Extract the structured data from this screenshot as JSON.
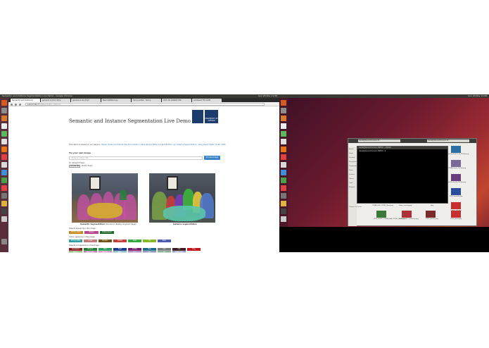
{
  "left_screen": {
    "topbar_title": "Semantic and Instance Segmentation Live Demo - Google Chrome",
    "topbar_tray": "Sun 20 Nov 11:38",
    "tabs": [
      "Semantic and Instance",
      "general matrix dims",
      "geneva-1-G2_Expr",
      "Nanodetfetch.py",
      "harry potter · fancy",
      "ICCV RL GRAND PRI",
      "unbiased TFA LMKI"
    ],
    "address": {
      "secure_label": "129.67.90.77",
      "path": "/deltavirtually_camera"
    },
    "page": {
      "title": "Semantic and Instance Segmentation Live Demo",
      "logo_text": "UNIVERSITY OF OXFORD",
      "intro_prefix": "This demo is based on our papers:",
      "intro_link1": "Higher Order Conditional Random Fields in Deep Neural Networks",
      "intro_mid": "and",
      "intro_link2": "Bottom-up Instance Segmentation using Deep Higher Order CRFs",
      "try_label": "Try your own image",
      "url_placeholder": "Enter an image URL",
      "process_button": "Process Image",
      "upload_label": "Or upload it here:",
      "choose_file": "Choose File",
      "no_file": "No file chosen",
      "caption_sem_bold": "Semantic Segmentation",
      "caption_sem_rest": "(mouse to display original image)",
      "caption_ins": "Instance segmentation",
      "legend_appearing": "Objects appearing in the image:",
      "legend_appearing_badges": [
        {
          "label": "Dining table",
          "color": "#c58a1e"
        },
        {
          "label": "Person",
          "color": "#b5488f"
        },
        {
          "label": "Potted plant",
          "color": "#1e6b2e"
        }
      ],
      "legend_indoor": "Indoor appearing in the image:",
      "legend_indoor_badges": [
        {
          "label": "Dining table",
          "color": "#2e9fa0"
        },
        {
          "label": "Chair",
          "color": "#c07a7a"
        },
        {
          "label": "Monitor",
          "color": "#6d5418"
        },
        {
          "label": "Bottle",
          "color": "#c0403a"
        },
        {
          "label": "Sofa",
          "color": "#3aa845"
        },
        {
          "label": "TV",
          "color": "#8ab82a"
        },
        {
          "label": "Plant",
          "color": "#4d5ab0"
        }
      ],
      "legend_not": "Objects not appearing in the image:",
      "legend_not_badges_row1": [
        {
          "label": "Aeroplane",
          "color": "#8a1e1e"
        },
        {
          "label": "Bicycle",
          "color": "#1e7a2e"
        },
        {
          "label": "Bird",
          "color": "#2e9f5a"
        },
        {
          "label": "Boat",
          "color": "#1e3c8a"
        },
        {
          "label": "Bottle",
          "color": "#7a1e6b"
        },
        {
          "label": "Bus",
          "color": "#1e6b8a"
        },
        {
          "label": "Car",
          "color": "#7a7a7a"
        },
        {
          "label": "Cat",
          "color": "#3c1e1e"
        },
        {
          "label": "Dog",
          "color": "#c0181e"
        }
      ],
      "legend_not_badges_row2": [
        {
          "label": "Horse",
          "color": "#3a8a2a"
        },
        {
          "label": "Motorbike",
          "color": "#8a1e8a"
        },
        {
          "label": "Sheep",
          "color": "#c03aa0"
        },
        {
          "label": "Train",
          "color": "#2a8ab0"
        },
        {
          "label": "Cow",
          "color": "#6b3a8a"
        },
        {
          "label": "Cat",
          "color": "#3a3a8a"
        },
        {
          "label": "TV",
          "color": "#2a6b3a"
        },
        {
          "label": "TV/Monitor",
          "color": "#3a5ab0"
        }
      ]
    }
  },
  "right_screen": {
    "topbar_tray": "Sun 20 Nov 11:38",
    "filemanager_tabs": [
      "daniel@daniel-Precision-M...",
      "daniel@daniel-Precision-M..."
    ],
    "sidebar_items": [
      "Places",
      "Home",
      "Desktop",
      "Documents",
      "Downloads",
      "Music",
      "Pictures",
      "Videos",
      "Trash",
      "Network",
      "Connect to Server"
    ],
    "terminal_title": "daniel@daniel-Precision-M4800: ~/deltaD",
    "terminal_line": "daniel@daniel-Precision-M4800:~$",
    "files_right": [
      "2010_001577_2s_TVObjt.png",
      "TV588_sheet_TVObjt.png",
      "2010_dereful_TVObjt.png",
      "2010_derdedt.png",
      "image_tail.png"
    ],
    "files_bottom": [
      {
        "name": "TV588_000_TVCNS_Obstr.png"
      },
      {
        "name": "shape_overlay.png"
      },
      {
        "name": "png"
      },
      {
        "name": "2010_001577_TV588_SAR_TVCNS_Obstr.png"
      },
      {
        "name": "2010_001577_Instance.png"
      },
      {
        "name": "2010_dereful.png"
      },
      {
        "name": "2010_derfd.png"
      }
    ]
  }
}
